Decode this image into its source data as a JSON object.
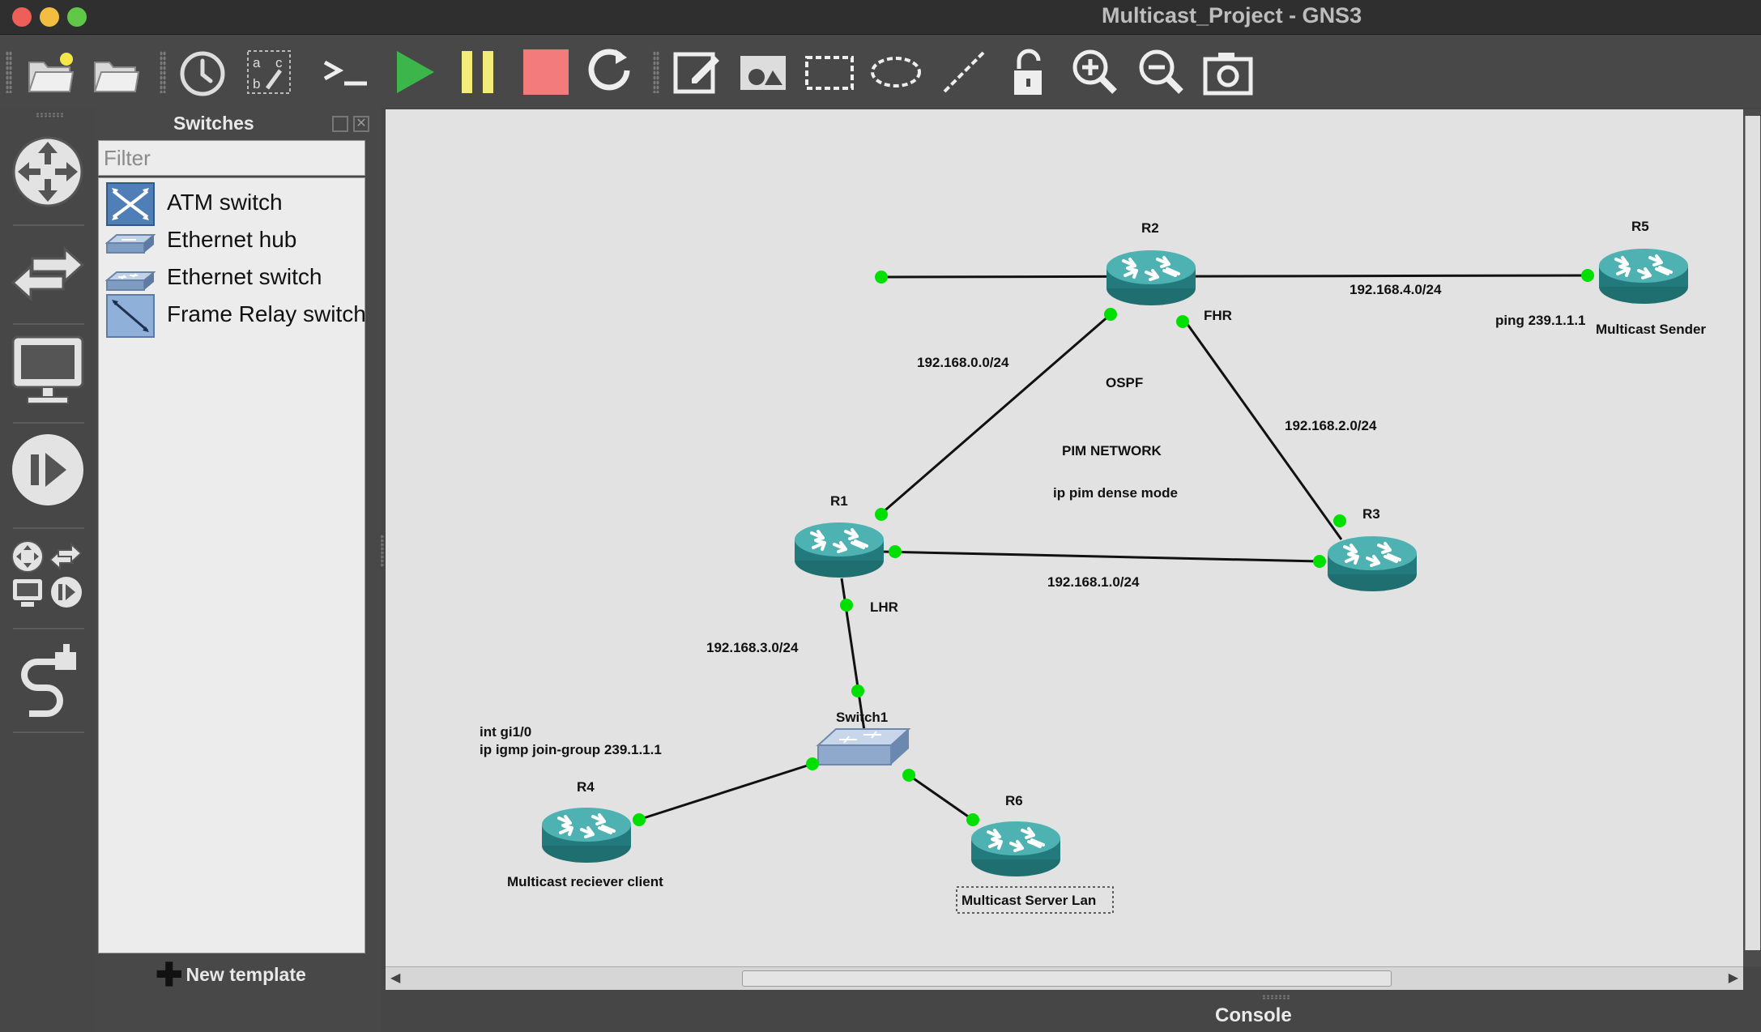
{
  "window": {
    "title": "Multicast_Project - GNS3",
    "traffic_lights": [
      "close",
      "minimize",
      "zoom"
    ]
  },
  "toolbar": {
    "buttons": [
      "new-project-icon",
      "open-project-icon",
      "snapshot-clock-icon",
      "show-interface-labels-icon",
      "console-all-icon",
      "start-all-icon",
      "suspend-all-icon",
      "stop-all-icon",
      "reload-all-icon",
      "add-note-icon",
      "insert-picture-icon",
      "draw-rectangle-icon",
      "draw-ellipse-icon",
      "draw-line-icon",
      "lock-items-icon",
      "zoom-in-icon",
      "zoom-out-icon",
      "screenshot-icon"
    ]
  },
  "sidebar": {
    "items": [
      "browse-routers-icon",
      "browse-switches-icon",
      "browse-end-devices-icon",
      "browse-security-devices-icon",
      "browse-all-devices-icon",
      "add-link-icon"
    ]
  },
  "dock": {
    "title": "Switches",
    "filter_placeholder": "Filter",
    "items": [
      {
        "label": "ATM switch",
        "icon": "atm-switch-icon"
      },
      {
        "label": "Ethernet hub",
        "icon": "ethernet-hub-icon"
      },
      {
        "label": "Ethernet switch",
        "icon": "ethernet-switch-icon"
      },
      {
        "label": "Frame Relay switch",
        "icon": "frame-relay-switch-icon"
      }
    ],
    "new_template": "New template"
  },
  "topology": {
    "nodes": {
      "r1": "R1",
      "r2": "R2",
      "r3": "R3",
      "r4": "R4",
      "r5": "R5",
      "r6": "R6",
      "switch1": "Switch1"
    },
    "links": {
      "r2_r5": "192.168.4.0/24",
      "r1_r2": "192.168.0.0/24",
      "r2_r3": "192.168.2.0/24",
      "r1_r3": "192.168.1.0/24",
      "r1_sw": "192.168.3.0/24"
    },
    "notes": {
      "fhr": "FHR",
      "lhr": "LHR",
      "ospf": "OSPF",
      "pim_network": "PIM NETWORK",
      "pim_mode": "ip pim dense mode",
      "ping": "ping 239.1.1.1",
      "sender": "Multicast Sender",
      "int": "int gi1/0",
      "igmp": "ip igmp join-group 239.1.1.1",
      "receiver": "Multicast reciever client",
      "server": "Multicast Server Lan"
    }
  },
  "console": {
    "label": "Console"
  },
  "colors": {
    "link_up": "#00e000",
    "router": "#2b8a8c",
    "canvas": "#e2e2e2"
  }
}
